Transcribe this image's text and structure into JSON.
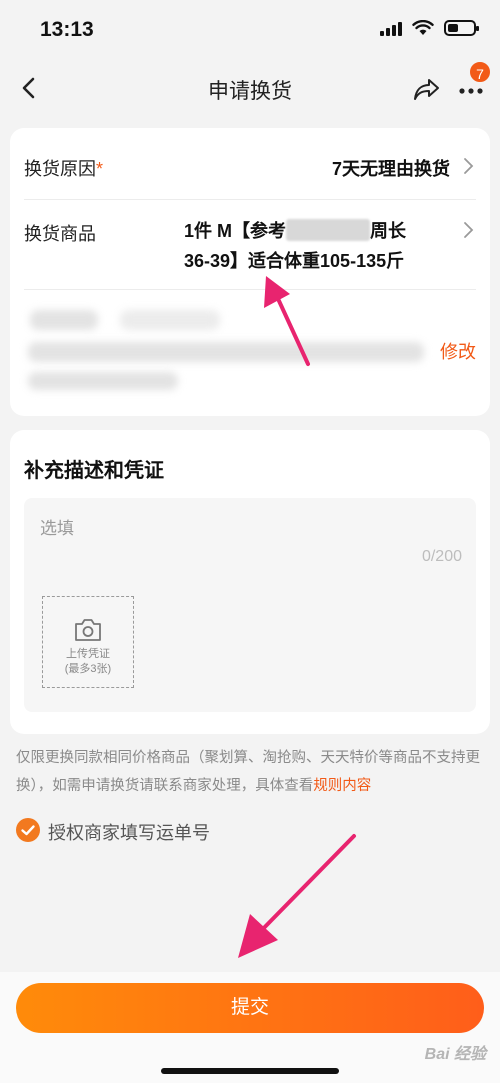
{
  "status_bar": {
    "time": "13:13"
  },
  "nav": {
    "title": "申请换货",
    "badge_count": "7"
  },
  "exchange": {
    "reason_label": "换货原因",
    "required_mark": "*",
    "reason_value": "7天无理由换货",
    "item_label": "换货商品",
    "item_value_part1": "1件 M【参考",
    "item_value_part2": "周长",
    "item_value_line2": "36-39】适合体重105-135斤",
    "modify_label": "修改"
  },
  "supplement": {
    "title": "补充描述和凭证",
    "placeholder": "选填",
    "char_count": "0/200",
    "upload_label": "上传凭证",
    "upload_limit": "(最多3张)"
  },
  "notice": {
    "text": "仅限更换同款相同价格商品（聚划算、淘抢购、天天特价等商品不支持更换），如需申请换货请联系商家处理，具体查看",
    "link_text": "规则内容"
  },
  "authorize": {
    "label": "授权商家填写运单号",
    "checked": true
  },
  "submit": {
    "label": "提交"
  },
  "watermark": {
    "text": "Bai 经验"
  },
  "colors": {
    "accent": "#f25a17",
    "button_start": "#ff8b0a",
    "button_end": "#ff5e1a",
    "annotation": "#e8246f"
  }
}
